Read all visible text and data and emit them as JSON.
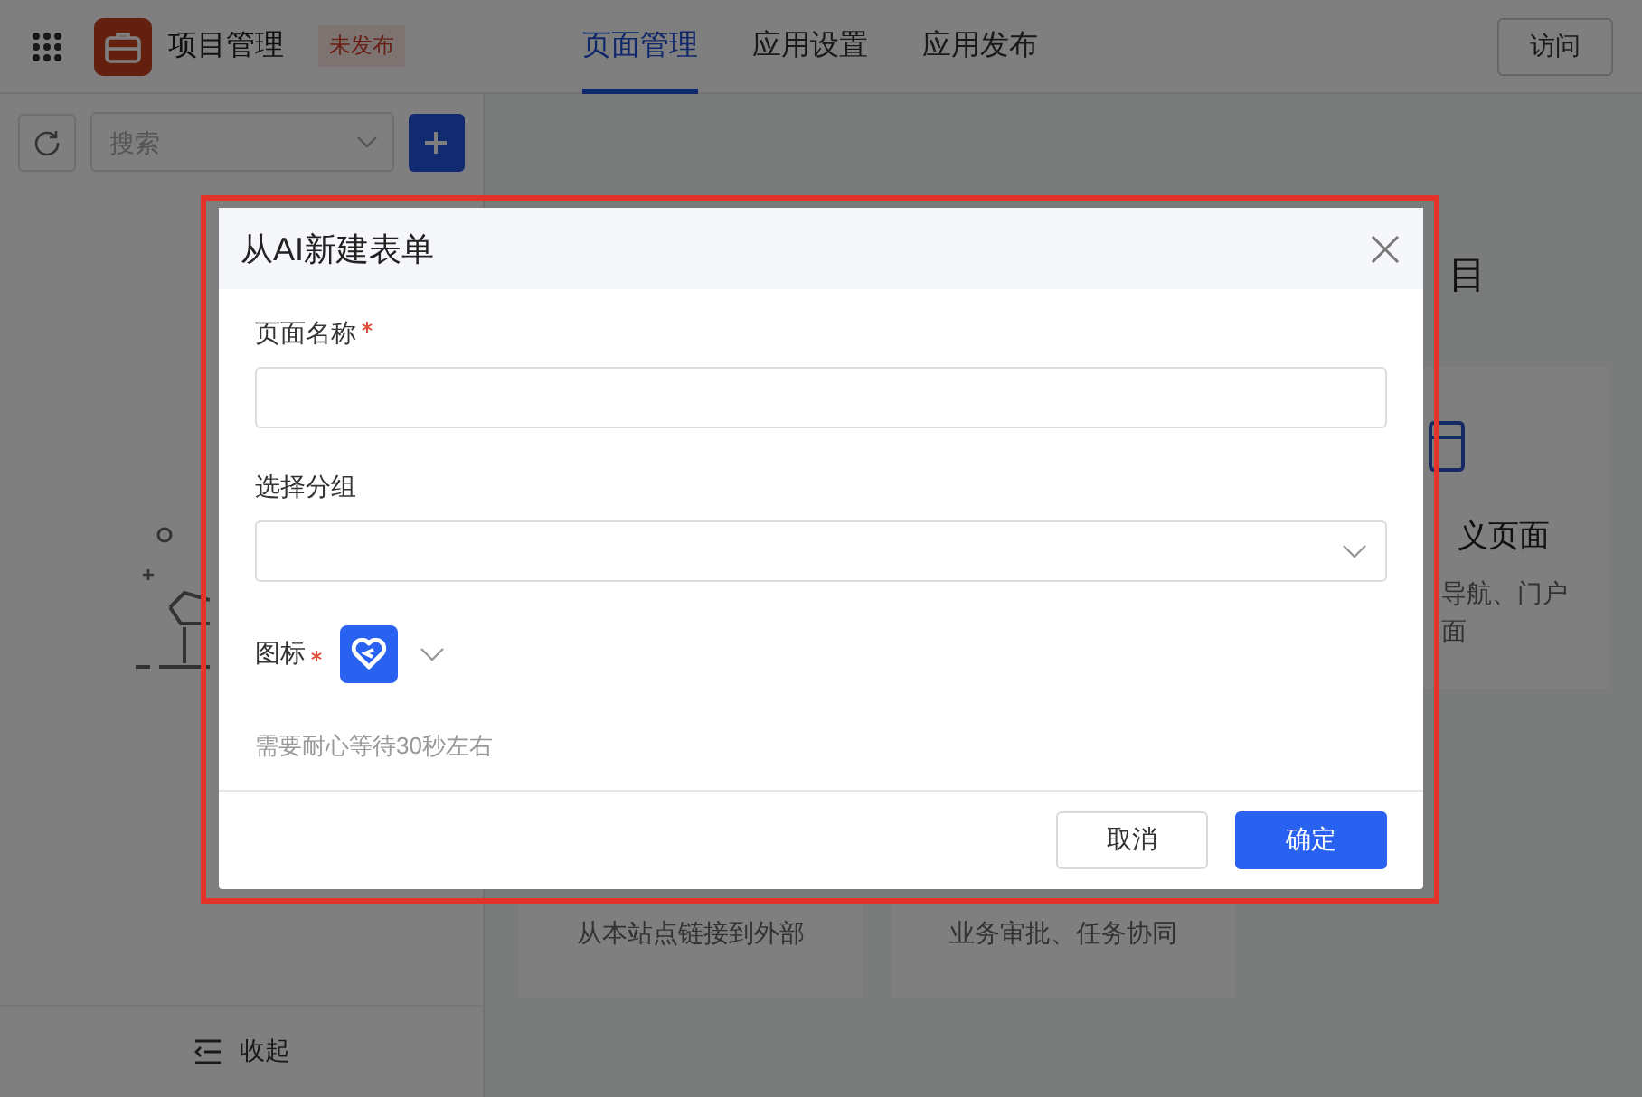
{
  "header": {
    "app_name": "项目管理",
    "status_badge": "未发布",
    "visit_button": "访问",
    "tabs": [
      {
        "label": "页面管理",
        "selected": true
      },
      {
        "label": "应用设置",
        "selected": false
      },
      {
        "label": "应用发布",
        "selected": false
      }
    ]
  },
  "sidebar": {
    "search": {
      "placeholder": "搜索"
    },
    "collapse_label": "收起"
  },
  "main": {
    "heading_fragment": "目",
    "side_card": {
      "title": "义页面",
      "description_lines": [
        "导航、门户",
        "面"
      ]
    },
    "bottom_cards": [
      {
        "description": "从本站点链接到外部"
      },
      {
        "description": "业务审批、任务协同"
      }
    ]
  },
  "dialog": {
    "title": "从AI新建表单",
    "hint": "需要耐心等待30秒左右",
    "fields": [
      {
        "kind": "text",
        "label": "页面名称",
        "required": true
      },
      {
        "kind": "select",
        "label": "选择分组",
        "required": false
      },
      {
        "kind": "icon",
        "label": "图标",
        "required": true
      }
    ],
    "buttons": [
      {
        "label": "取消",
        "primary": false
      },
      {
        "label": "确定",
        "primary": true
      }
    ]
  }
}
